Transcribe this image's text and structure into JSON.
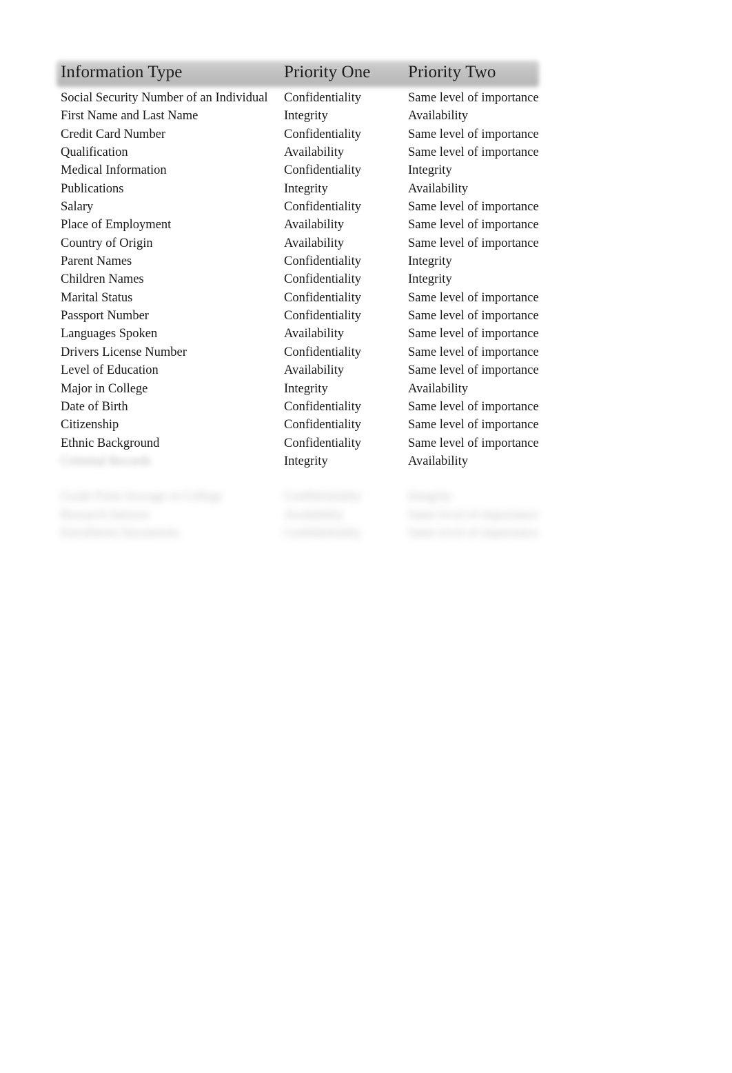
{
  "document": {
    "kind": "table",
    "background_color": "#ffffff",
    "text_color": "#171717",
    "header_band_color": "#bdbdbd"
  },
  "table": {
    "columns": [
      {
        "key": "information_type",
        "label": "Information Type"
      },
      {
        "key": "priority_one",
        "label": "Priority One"
      },
      {
        "key": "priority_two",
        "label": "Priority Two"
      }
    ],
    "rows": [
      {
        "information_type": "Social Security Number of an Individual",
        "priority_one": "Confidentiality",
        "priority_two": "Same level of importance",
        "redacted": false
      },
      {
        "information_type": "First Name and Last Name",
        "priority_one": "Integrity",
        "priority_two": "Availability",
        "redacted": false
      },
      {
        "information_type": "Credit Card Number",
        "priority_one": "Confidentiality",
        "priority_two": "Same level of importance",
        "redacted": false
      },
      {
        "information_type": "Qualification",
        "priority_one": "Availability",
        "priority_two": "Same level of importance",
        "redacted": false
      },
      {
        "information_type": "Medical Information",
        "priority_one": "Confidentiality",
        "priority_two": "Integrity",
        "redacted": false
      },
      {
        "information_type": "Publications",
        "priority_one": "Integrity",
        "priority_two": "Availability",
        "redacted": false
      },
      {
        "information_type": "Salary",
        "priority_one": "Confidentiality",
        "priority_two": "Same level of importance",
        "redacted": false
      },
      {
        "information_type": "Place of Employment",
        "priority_one": "Availability",
        "priority_two": "Same level of importance",
        "redacted": false
      },
      {
        "information_type": "Country of Origin",
        "priority_one": "Availability",
        "priority_two": "Same level of importance",
        "redacted": false
      },
      {
        "information_type": "Parent Names",
        "priority_one": "Confidentiality",
        "priority_two": "Integrity",
        "redacted": false
      },
      {
        "information_type": "Children Names",
        "priority_one": "Confidentiality",
        "priority_two": "Integrity",
        "redacted": false
      },
      {
        "information_type": "Marital Status",
        "priority_one": "Confidentiality",
        "priority_two": "Same level of importance",
        "redacted": false
      },
      {
        "information_type": "Passport Number",
        "priority_one": "Confidentiality",
        "priority_two": "Same level of importance",
        "redacted": false
      },
      {
        "information_type": "Languages Spoken",
        "priority_one": "Availability",
        "priority_two": "Same level of importance",
        "redacted": false
      },
      {
        "information_type": "Drivers License Number",
        "priority_one": "Confidentiality",
        "priority_two": "Same level of importance",
        "redacted": false
      },
      {
        "information_type": "Level of Education",
        "priority_one": "Availability",
        "priority_two": "Same level of importance",
        "redacted": false
      },
      {
        "information_type": "Major in College",
        "priority_one": "Integrity",
        "priority_two": "Availability",
        "redacted": false
      },
      {
        "information_type": "Date of Birth",
        "priority_one": "Confidentiality",
        "priority_two": "Same level of importance",
        "redacted": false
      },
      {
        "information_type": "Citizenship",
        "priority_one": "Confidentiality",
        "priority_two": "Same level of importance",
        "redacted": false
      },
      {
        "information_type": "Ethnic Background",
        "priority_one": "Confidentiality",
        "priority_two": "Same level of importance",
        "redacted": false
      },
      {
        "information_type": "Criminal Records",
        "priority_one": "Integrity",
        "priority_two": "Availability",
        "redacted_cells": [
          "information_type"
        ]
      }
    ],
    "trailing_rows": [
      {
        "information_type": "Grade Point Average in College",
        "priority_one": "Confidentiality",
        "priority_two": "Integrity",
        "redacted": true
      },
      {
        "information_type": "Research Interest",
        "priority_one": "Availability",
        "priority_two": "Same level of importance",
        "redacted": true
      },
      {
        "information_type": "Enrollment Documents",
        "priority_one": "Confidentiality",
        "priority_two": "Same level of importance",
        "redacted": true
      }
    ]
  }
}
